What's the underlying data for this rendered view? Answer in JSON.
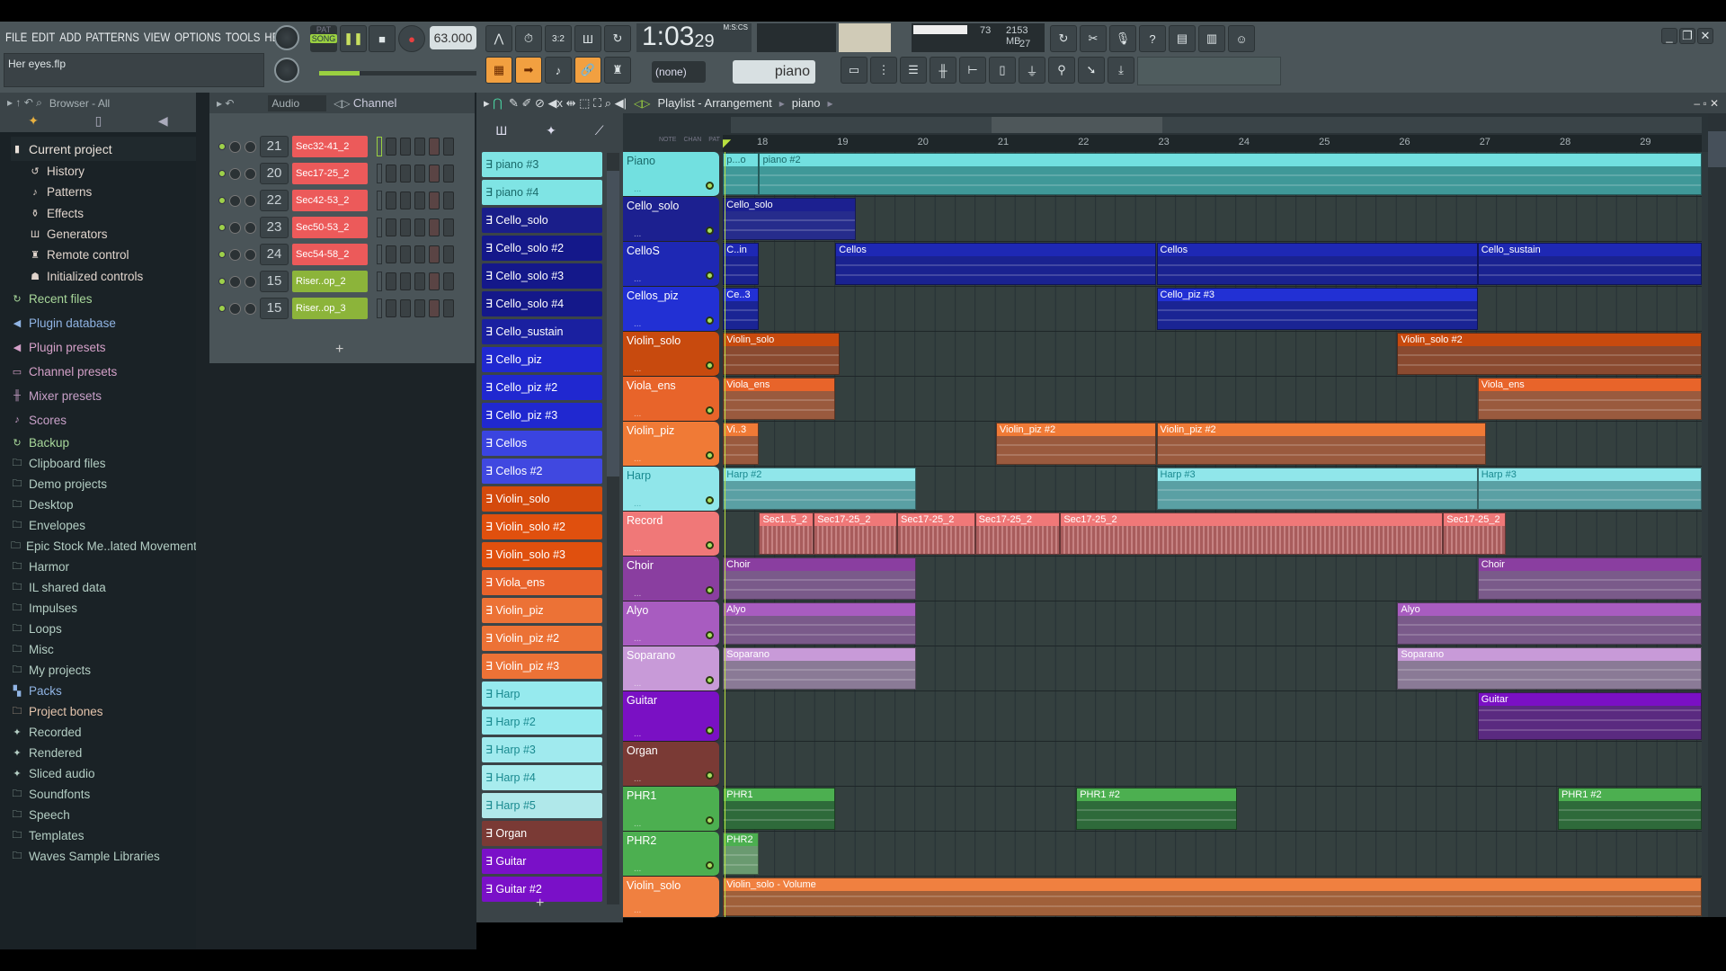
{
  "menu": [
    "FILE",
    "EDIT",
    "ADD",
    "PATTERNS",
    "VIEW",
    "OPTIONS",
    "TOOLS",
    "HELP"
  ],
  "transport": {
    "pat": "PAT",
    "song": "SONG",
    "tempo": "63.000",
    "time": "1:03",
    "time_cs": "29",
    "time_label": "M:S:CS",
    "cpu": "73",
    "memory": "2153 MB",
    "polyphony": "27"
  },
  "hint": {
    "filename": "Her eyes.flp"
  },
  "toolbar2": {
    "snap": "(none)",
    "pattern": "piano"
  },
  "browser": {
    "title": "Browser - All",
    "items": [
      {
        "label": "Current project",
        "kind": "top",
        "icon": "project-icon",
        "color": "#e8e0d8"
      },
      {
        "label": "History",
        "kind": "sub",
        "icon": "history-icon",
        "color": "#e0d4cc"
      },
      {
        "label": "Patterns",
        "kind": "sub",
        "icon": "note-icon",
        "color": "#e0d4cc"
      },
      {
        "label": "Effects",
        "kind": "sub",
        "icon": "effects-icon",
        "color": "#e0d4cc"
      },
      {
        "label": "Generators",
        "kind": "sub",
        "icon": "generator-icon",
        "color": "#e0d4cc"
      },
      {
        "label": "Remote control",
        "kind": "sub",
        "icon": "remote-icon",
        "color": "#e0d4cc"
      },
      {
        "label": "Initialized controls",
        "kind": "sub",
        "icon": "controls-icon",
        "color": "#e0d4cc"
      },
      {
        "label": "Recent files",
        "kind": "sect",
        "icon": "recent-icon",
        "color": "#a8d89a"
      },
      {
        "label": "Plugin database",
        "kind": "sect",
        "icon": "plugin-icon",
        "color": "#90b4e4"
      },
      {
        "label": "Plugin presets",
        "kind": "sect",
        "icon": "plugin-icon",
        "color": "#d4a0c8"
      },
      {
        "label": "Channel presets",
        "kind": "sect",
        "icon": "channel-icon",
        "color": "#d4a0c8"
      },
      {
        "label": "Mixer presets",
        "kind": "sect",
        "icon": "mixer-icon",
        "color": "#c8a0c8"
      },
      {
        "label": "Scores",
        "kind": "sect",
        "icon": "note-icon",
        "color": "#c8a0c8"
      },
      {
        "label": "Backup",
        "kind": "f",
        "icon": "backup-icon",
        "color": "#a8d89a"
      },
      {
        "label": "Clipboard files",
        "kind": "f",
        "icon": "folder-icon",
        "color": "#b4cec4"
      },
      {
        "label": "Demo projects",
        "kind": "f",
        "icon": "folder-icon",
        "color": "#b4cec4"
      },
      {
        "label": "Desktop",
        "kind": "f",
        "icon": "folder-icon",
        "color": "#b4cec4"
      },
      {
        "label": "Envelopes",
        "kind": "f",
        "icon": "folder-icon",
        "color": "#b4cec4"
      },
      {
        "label": "Epic Stock Me..lated Movement",
        "kind": "f",
        "icon": "folder-icon",
        "color": "#b4cec4"
      },
      {
        "label": "Harmor",
        "kind": "f",
        "icon": "folder-icon",
        "color": "#b4cec4"
      },
      {
        "label": "IL shared data",
        "kind": "f",
        "icon": "folder-icon",
        "color": "#b4cec4"
      },
      {
        "label": "Impulses",
        "kind": "f",
        "icon": "folder-icon",
        "color": "#b4cec4"
      },
      {
        "label": "Loops",
        "kind": "f",
        "icon": "folder-icon",
        "color": "#b4cec4"
      },
      {
        "label": "Misc",
        "kind": "f",
        "icon": "folder-icon",
        "color": "#b4cec4"
      },
      {
        "label": "My projects",
        "kind": "f",
        "icon": "folder-icon",
        "color": "#b4cec4"
      },
      {
        "label": "Packs",
        "kind": "f",
        "icon": "packs-icon",
        "color": "#90b4e4"
      },
      {
        "label": "Project bones",
        "kind": "f",
        "icon": "folder-icon",
        "color": "#e4c4ac"
      },
      {
        "label": "Recorded",
        "kind": "f",
        "icon": "waveform-icon",
        "color": "#b4cec4"
      },
      {
        "label": "Rendered",
        "kind": "f",
        "icon": "waveform-icon",
        "color": "#b4cec4"
      },
      {
        "label": "Sliced audio",
        "kind": "f",
        "icon": "waveform-icon",
        "color": "#b4cec4"
      },
      {
        "label": "Soundfonts",
        "kind": "f",
        "icon": "folder-icon",
        "color": "#b4cec4"
      },
      {
        "label": "Speech",
        "kind": "f",
        "icon": "folder-icon",
        "color": "#b4cec4"
      },
      {
        "label": "Templates",
        "kind": "f",
        "icon": "folder-icon",
        "color": "#b4cec4"
      },
      {
        "label": "Waves Sample Libraries",
        "kind": "f",
        "icon": "folder-icon",
        "color": "#b4cec4"
      }
    ]
  },
  "channel_rack": {
    "filter": "Audio",
    "title": "Channel",
    "add": "+",
    "channels": [
      {
        "mixer": "21",
        "name": "Sec32-41_2",
        "color": "#ec5a5a"
      },
      {
        "mixer": "20",
        "name": "Sec17-25_2",
        "color": "#ec5a5a"
      },
      {
        "mixer": "22",
        "name": "Sec42-53_2",
        "color": "#ec5a5a"
      },
      {
        "mixer": "23",
        "name": "Sec50-53_2",
        "color": "#ec5a5a"
      },
      {
        "mixer": "24",
        "name": "Sec54-58_2",
        "color": "#ec5a5a"
      },
      {
        "mixer": "15",
        "name": "Riser..op_2",
        "color": "#8cb43a"
      },
      {
        "mixer": "15",
        "name": "Riser..op_3",
        "color": "#8cb43a"
      }
    ]
  },
  "picker": {
    "add": "+",
    "items": [
      {
        "label": "piano #3",
        "color": "#7fe4e4",
        "text": "#1a6a6a"
      },
      {
        "label": "piano #4",
        "color": "#7fe4e4",
        "text": "#1a6a6a"
      },
      {
        "label": "Cello_solo",
        "color": "#1a1e8a"
      },
      {
        "label": "Cello_solo #2",
        "color": "#14188a"
      },
      {
        "label": "Cello_solo #3",
        "color": "#14188a"
      },
      {
        "label": "Cello_solo #4",
        "color": "#14188a"
      },
      {
        "label": "Cello_sustain",
        "color": "#1a20a0"
      },
      {
        "label": "Cello_piz",
        "color": "#2028d0"
      },
      {
        "label": "Cello_piz #2",
        "color": "#2028d0"
      },
      {
        "label": "Cello_piz #3",
        "color": "#2028d0"
      },
      {
        "label": "Cellos",
        "color": "#3a44e0"
      },
      {
        "label": "Cellos #2",
        "color": "#4048e0"
      },
      {
        "label": "Violin_solo",
        "color": "#d44a0c"
      },
      {
        "label": "Violin_solo #2",
        "color": "#e0500e"
      },
      {
        "label": "Violin_solo #3",
        "color": "#e0500e"
      },
      {
        "label": "Viola_ens",
        "color": "#e8622a"
      },
      {
        "label": "Violin_piz",
        "color": "#ec7236"
      },
      {
        "label": "Violin_piz #2",
        "color": "#ec7236"
      },
      {
        "label": "Violin_piz #3",
        "color": "#ec7236"
      },
      {
        "label": "Harp",
        "color": "#96eaee",
        "text": "#1a8a90"
      },
      {
        "label": "Harp #2",
        "color": "#96eaee",
        "text": "#1a8a90"
      },
      {
        "label": "Harp #3",
        "color": "#a0eaee",
        "text": "#1a8a90"
      },
      {
        "label": "Harp #4",
        "color": "#a8ecee",
        "text": "#1a8a90"
      },
      {
        "label": "Harp #5",
        "color": "#b0e8ea",
        "text": "#1a8a90"
      },
      {
        "label": "Organ",
        "color": "#7a3a35"
      },
      {
        "label": "Guitar",
        "color": "#7a10c8"
      },
      {
        "label": "Guitar #2",
        "color": "#7a10c8"
      }
    ]
  },
  "playlist": {
    "title": "Playlist - Arrangement",
    "pattern": "piano",
    "ruler_labels": [
      "NOTE",
      "CHAN",
      "PAT"
    ],
    "bars": [
      "18",
      "19",
      "20",
      "21",
      "22",
      "23",
      "24",
      "25",
      "26",
      "27",
      "28",
      "29"
    ],
    "tracks": [
      {
        "name": "Piano",
        "color": "#72e0e0",
        "text": "#1a6a6a",
        "clip": "#3f9898"
      },
      {
        "name": "Cello_solo",
        "color": "#1c2090",
        "clip": "#262c8c"
      },
      {
        "name": "CelloS",
        "color": "#1e28b4",
        "clip": "#1a2290"
      },
      {
        "name": "Cellos_piz",
        "color": "#2230d4",
        "clip": "#1a2494"
      },
      {
        "name": "Violin_solo",
        "color": "#c84a0e",
        "clip": "#8a4a30"
      },
      {
        "name": "Viola_ens",
        "color": "#e8642a",
        "clip": "#9a5a3e"
      },
      {
        "name": "Violin_piz",
        "color": "#f07a36",
        "clip": "#9a5a3e"
      },
      {
        "name": "Harp",
        "color": "#90e6ea",
        "text": "#1a8a90",
        "clip": "#5aa0a4"
      },
      {
        "name": "Record",
        "color": "#f07878",
        "clip": "#a85c5c"
      },
      {
        "name": "Choir",
        "color": "#8a3ea0",
        "clip": "#7a5a8a"
      },
      {
        "name": "Alyo",
        "color": "#a85cc0",
        "clip": "#7a5a8a"
      },
      {
        "name": "Soparano",
        "color": "#c89ad8",
        "clip": "#8a7a96"
      },
      {
        "name": "Guitar",
        "color": "#7a10c4",
        "clip": "#5a2a80"
      },
      {
        "name": "Organ",
        "color": "#7a3a35",
        "clip": "#5a3a35"
      },
      {
        "name": "PHR1",
        "color": "#4caf50",
        "clip": "#2e6a3a"
      },
      {
        "name": "PHR2",
        "color": "#4caf50",
        "clip": "#6a9a70"
      },
      {
        "name": "Violin_solo",
        "color": "#f08040",
        "clip": "#a0603a"
      }
    ],
    "clips": [
      {
        "track": 0,
        "start": 17.6,
        "end": 18.05,
        "label": "p...o"
      },
      {
        "track": 0,
        "start": 18.05,
        "end": 30,
        "label": "piano #2"
      },
      {
        "track": 1,
        "start": 17.6,
        "end": 19.25,
        "label": "Cello_solo"
      },
      {
        "track": 2,
        "start": 17.6,
        "end": 18.05,
        "label": "C..in"
      },
      {
        "track": 2,
        "start": 19,
        "end": 23,
        "label": "Cellos"
      },
      {
        "track": 2,
        "start": 23,
        "end": 27,
        "label": "Cellos"
      },
      {
        "track": 2,
        "start": 27,
        "end": 30,
        "label": "Cello_sustain"
      },
      {
        "track": 3,
        "start": 17.6,
        "end": 18.05,
        "label": "Ce..3"
      },
      {
        "track": 3,
        "start": 23,
        "end": 27,
        "label": "Cello_piz #3"
      },
      {
        "track": 4,
        "start": 17.6,
        "end": 19.05,
        "label": "Violin_solo"
      },
      {
        "track": 4,
        "start": 26,
        "end": 30,
        "label": "Violin_solo #2"
      },
      {
        "track": 5,
        "start": 17.6,
        "end": 19,
        "label": "Viola_ens"
      },
      {
        "track": 5,
        "start": 27,
        "end": 30,
        "label": "Viola_ens"
      },
      {
        "track": 6,
        "start": 17.6,
        "end": 18.05,
        "label": "Vi..3"
      },
      {
        "track": 6,
        "start": 21,
        "end": 23,
        "label": "Violin_piz #2"
      },
      {
        "track": 6,
        "start": 23,
        "end": 27.1,
        "label": "Violin_piz #2"
      },
      {
        "track": 7,
        "start": 17.6,
        "end": 20,
        "label": "Harp #2"
      },
      {
        "track": 7,
        "start": 23,
        "end": 27,
        "label": "Harp #3"
      },
      {
        "track": 7,
        "start": 27,
        "end": 30,
        "label": "Harp #3"
      },
      {
        "track": 8,
        "start": 18.05,
        "end": 18.73,
        "label": "Sec1..5_2",
        "audio": true
      },
      {
        "track": 8,
        "start": 18.73,
        "end": 19.77,
        "label": "Sec17-25_2",
        "audio": true
      },
      {
        "track": 8,
        "start": 19.77,
        "end": 20.74,
        "label": "Sec17-25_2",
        "audio": true
      },
      {
        "track": 8,
        "start": 20.74,
        "end": 21.8,
        "label": "Sec17-25_2",
        "audio": true
      },
      {
        "track": 8,
        "start": 21.8,
        "end": 26.57,
        "label": "Sec17-25_2",
        "audio": true
      },
      {
        "track": 8,
        "start": 26.57,
        "end": 27.35,
        "label": "Sec17-25_2",
        "audio": true
      },
      {
        "track": 9,
        "start": 17.6,
        "end": 20,
        "label": "Choir"
      },
      {
        "track": 9,
        "start": 27,
        "end": 30,
        "label": "Choir"
      },
      {
        "track": 10,
        "start": 17.6,
        "end": 20,
        "label": "Alyo"
      },
      {
        "track": 10,
        "start": 26,
        "end": 30,
        "label": "Alyo"
      },
      {
        "track": 11,
        "start": 17.6,
        "end": 20,
        "label": "Soparano"
      },
      {
        "track": 11,
        "start": 26,
        "end": 30,
        "label": "Soparano"
      },
      {
        "track": 12,
        "start": 27,
        "end": 30,
        "label": "Guitar"
      },
      {
        "track": 14,
        "start": 17.6,
        "end": 19,
        "label": "PHR1"
      },
      {
        "track": 14,
        "start": 22,
        "end": 24,
        "label": "PHR1 #2"
      },
      {
        "track": 14,
        "start": 28,
        "end": 30,
        "label": "PHR1 #2"
      },
      {
        "track": 15,
        "start": 17.6,
        "end": 18.05,
        "label": "PHR2"
      },
      {
        "track": 16,
        "start": 17.6,
        "end": 30,
        "label": "Violin_solo - Volume",
        "automation": true
      }
    ]
  }
}
